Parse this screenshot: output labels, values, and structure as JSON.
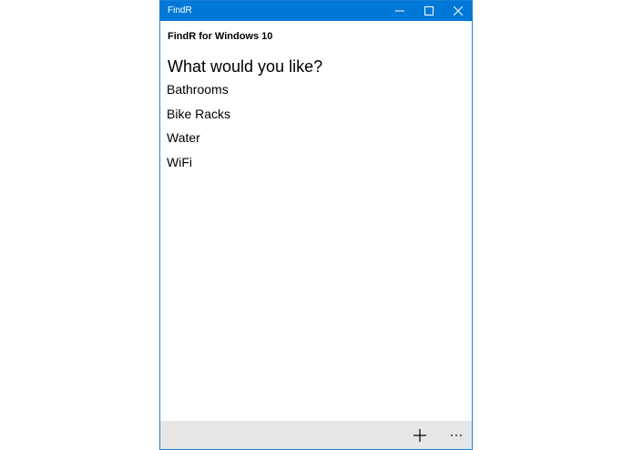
{
  "window": {
    "title": "FindR"
  },
  "app": {
    "header": "FindR for Windows 10",
    "prompt": "What would you like?",
    "options": [
      {
        "label": "Bathrooms"
      },
      {
        "label": "Bike Racks"
      },
      {
        "label": "Water"
      },
      {
        "label": "WiFi"
      }
    ]
  },
  "appbar": {
    "add_icon": "plus-icon",
    "more_icon": "ellipsis-icon"
  },
  "colors": {
    "titlebar": "#0078d7",
    "appbar": "#e6e6e6",
    "window_border": "#1a7fd4"
  }
}
